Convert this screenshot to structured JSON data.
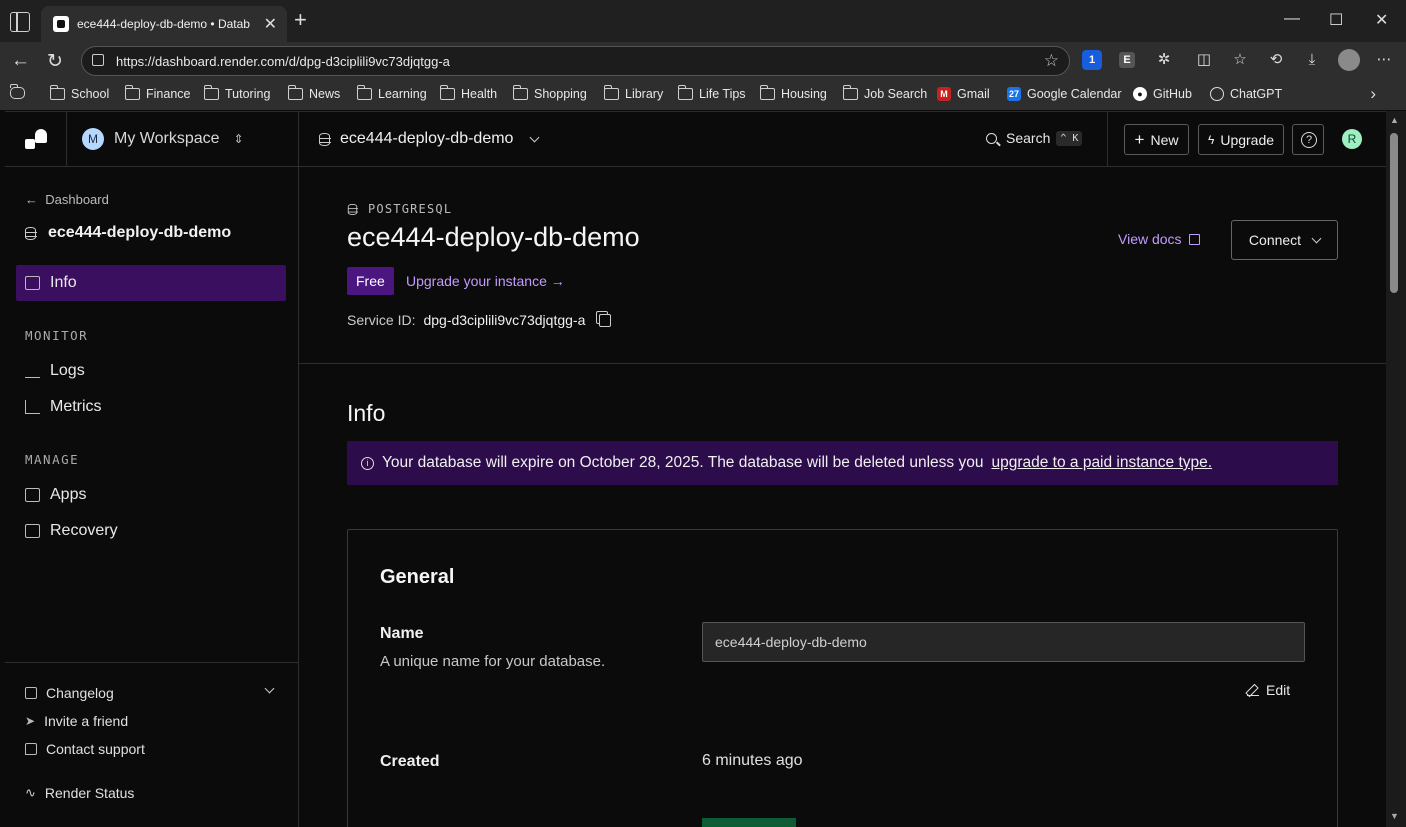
{
  "browser": {
    "tab_title": "ece444-deploy-db-demo • Datab",
    "url": "https://dashboard.render.com/d/dpg-d3ciplili9vc73djqtgg-a",
    "bookmarks": [
      "School",
      "Finance",
      "Tutoring",
      "News",
      "Learning",
      "Health",
      "Shopping",
      "Library",
      "Life Tips",
      "Housing",
      "Job Search"
    ],
    "apps": [
      "Gmail",
      "Google Calendar",
      "GitHub",
      "ChatGPT"
    ],
    "ext_bitwarden_count": "1",
    "ext_e": "E"
  },
  "topbar": {
    "workspace_initial": "M",
    "workspace": "My Workspace",
    "project": "ece444-deploy-db-demo",
    "search": "Search",
    "search_shortcut": "^ K",
    "new": "New",
    "upgrade": "Upgrade",
    "help": "?",
    "user_initial": "R"
  },
  "sidebar": {
    "back": "Dashboard",
    "service": "ece444-deploy-db-demo",
    "active": "Info",
    "monitor_label": "MONITOR",
    "monitor": [
      "Logs",
      "Metrics"
    ],
    "manage_label": "MANAGE",
    "manage": [
      "Apps",
      "Recovery"
    ],
    "footer": [
      "Changelog",
      "Invite a friend",
      "Contact support",
      "Render Status"
    ]
  },
  "header": {
    "type": "POSTGRESQL",
    "title": "ece444-deploy-db-demo",
    "plan": "Free",
    "upgrade_link": "Upgrade your instance →",
    "service_id_label": "Service ID:",
    "service_id": "dpg-d3ciplili9vc73djqtgg-a",
    "view_docs": "View docs",
    "connect": "Connect"
  },
  "info": {
    "heading": "Info",
    "alert_text": "Your database will expire on October 28, 2025. The database will be deleted unless you",
    "alert_link": "upgrade to a paid instance type.",
    "general": {
      "title": "General",
      "name_label": "Name",
      "name_desc": "A unique name for your database.",
      "name_value": "ece444-deploy-db-demo",
      "edit": "Edit",
      "created_label": "Created",
      "created_value": "6 minutes ago"
    }
  },
  "colors": {
    "accent": "#c39bff",
    "active_nav": "#3b0f5f",
    "free_badge": "#4b1680",
    "alert_bg": "#2c0c4a"
  }
}
